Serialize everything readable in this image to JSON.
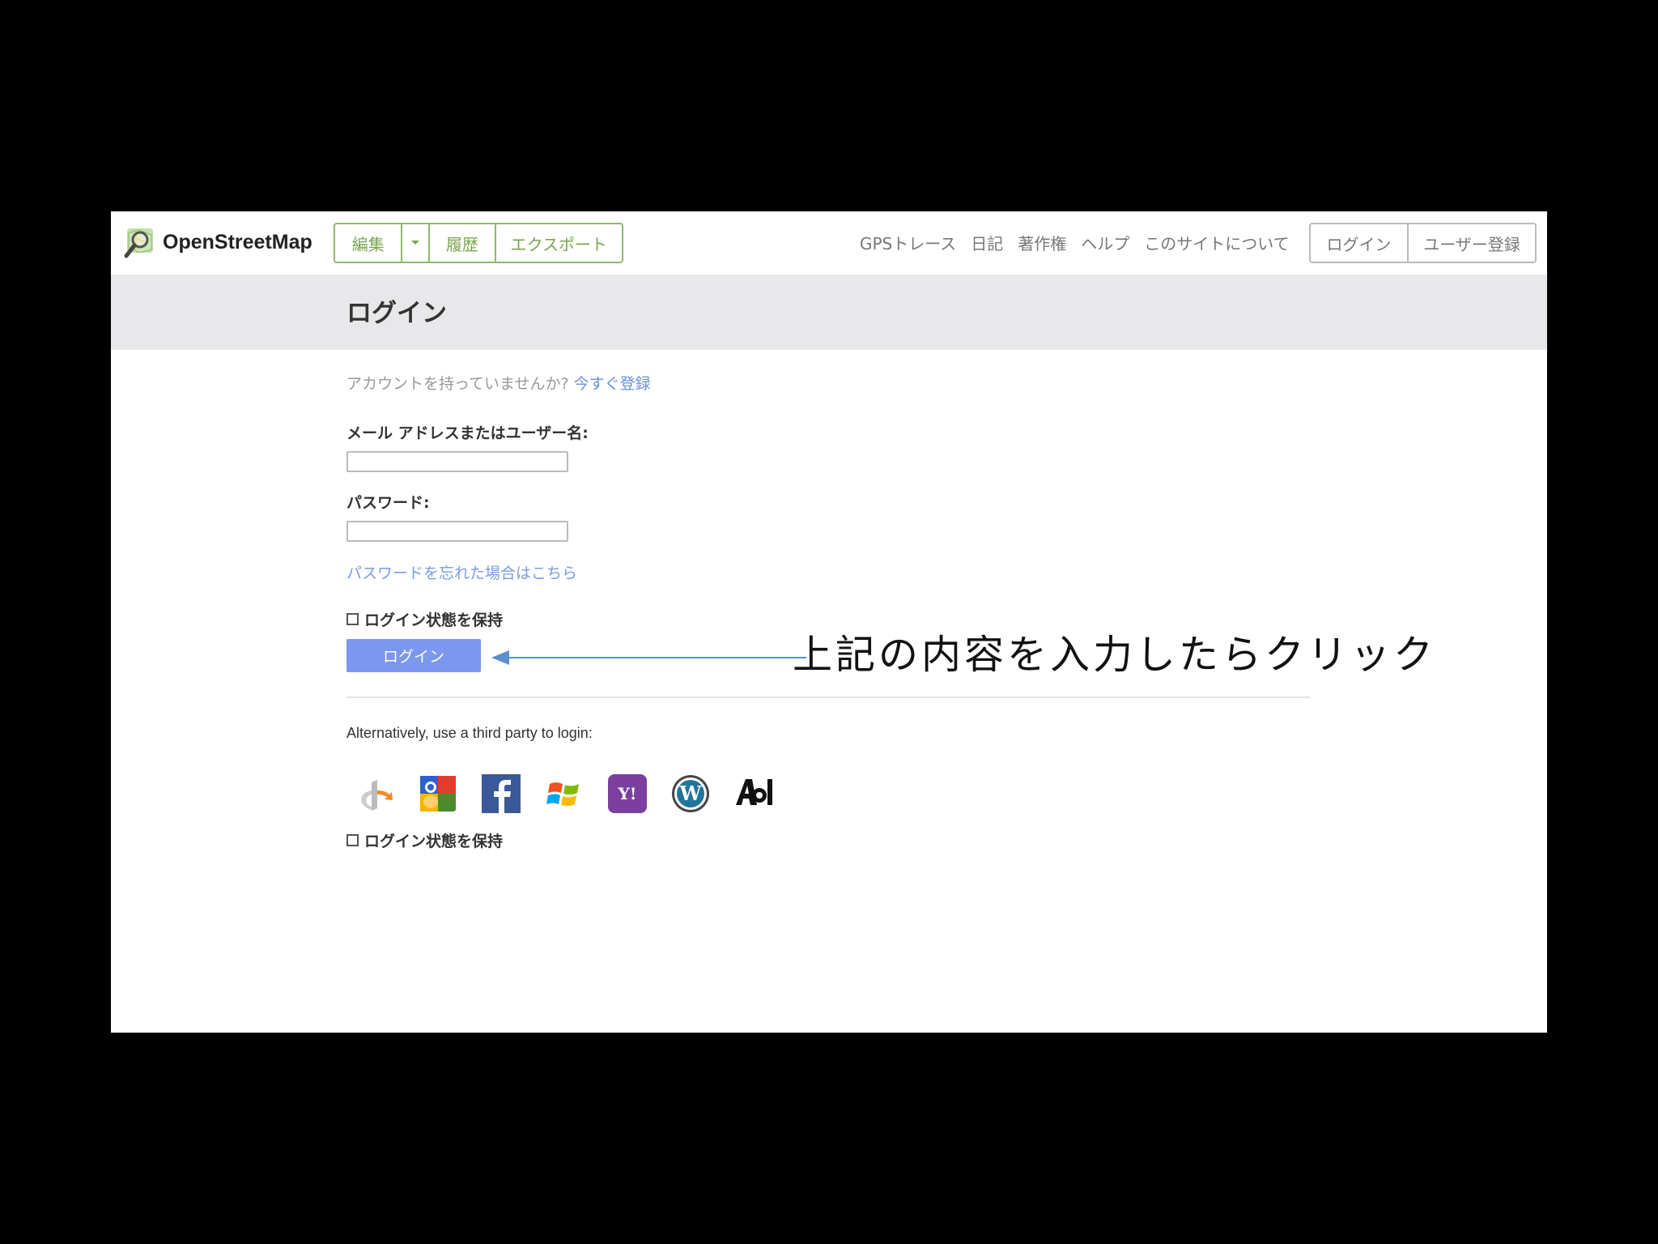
{
  "header": {
    "logo_text": "OpenStreetMap",
    "edit_label": "編集",
    "history_label": "履歴",
    "export_label": "エクスポート",
    "nav": {
      "gps": "GPSトレース",
      "diary": "日記",
      "copyright": "著作権",
      "help": "ヘルプ",
      "about": "このサイトについて"
    },
    "login_label": "ログイン",
    "signup_label": "ユーザー登録"
  },
  "page": {
    "title": "ログイン",
    "no_account_text": "アカウントを持っていませんか?",
    "register_link": "今すぐ登録",
    "email_label": "メール アドレスまたはユーザー名:",
    "email_value": "",
    "password_label": "パスワード:",
    "password_value": "",
    "forgot_link": "パスワードを忘れた場合はこちら",
    "remember_label": "ログイン状態を保持",
    "submit_label": "ログイン",
    "alt_login_text": "Alternatively, use a third party to login:",
    "remember_label_2": "ログイン状態を保持",
    "providers": [
      "openid-icon",
      "google-icon",
      "facebook-icon",
      "windows-live-icon",
      "yahoo-icon",
      "wordpress-icon",
      "aol-icon"
    ]
  },
  "annotation": {
    "text": "上記の内容を入力したらクリック"
  },
  "colors": {
    "accent_green": "#7aa64e",
    "link_blue": "#6a8fd8",
    "submit_blue": "#7c97ee",
    "title_band": "#e8e8ea",
    "annotation_arrow": "#5b8fd0"
  }
}
